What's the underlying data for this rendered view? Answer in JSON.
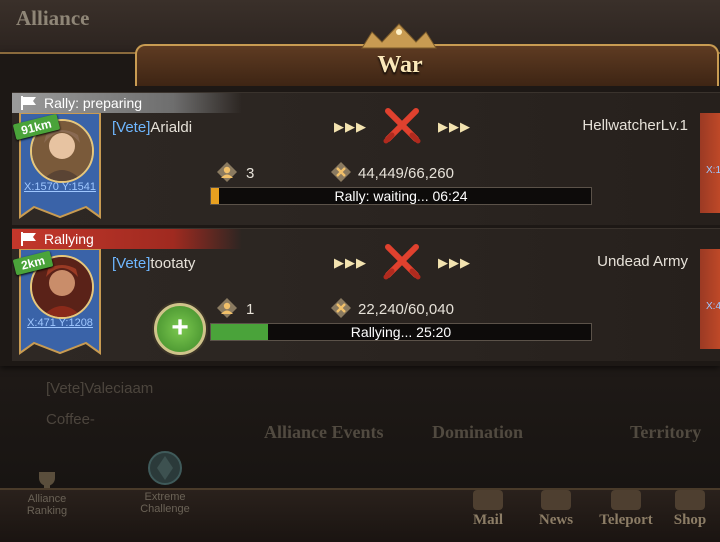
{
  "background": {
    "alliance_title": "Alliance",
    "members": [
      "[Vete]Valeciaam",
      "Coffee-"
    ],
    "tabs": [
      "Alliance Events",
      "Domination",
      "Territory"
    ],
    "left_buttons": [
      {
        "label": "Alliance Ranking",
        "icon": "trophy-icon"
      },
      {
        "label": "Extreme Challenge",
        "icon": "emblem-icon"
      }
    ],
    "bottom_nav": [
      {
        "label": "Mail",
        "icon": "mail-icon"
      },
      {
        "label": "News",
        "icon": "news-icon"
      },
      {
        "label": "Teleport",
        "icon": "teleport-icon"
      },
      {
        "label": "Shop",
        "icon": "shop-icon"
      }
    ]
  },
  "panel": {
    "title": "War"
  },
  "rallies": [
    {
      "status": "Rally: preparing",
      "status_color": "#8a8a8a",
      "distance": "91km",
      "coords": "X:1570 Y:1541",
      "leader_tag": "[Vete]",
      "leader_name": "Arialdi",
      "target": "HellwatcherLv.1",
      "participants": "3",
      "troops": "44,449/66,260",
      "progress_label": "Rally: waiting... 06:24",
      "progress": 0.02,
      "progress_color": "#e8a020",
      "edge_coords": "X:1"
    },
    {
      "status": "Rallying",
      "status_color": "#c3372b",
      "distance": "2km",
      "coords": "X:471 Y:1208",
      "leader_tag": "[Vete]",
      "leader_name": "tootaty",
      "target": "Undead Army",
      "participants": "1",
      "troops": "22,240/60,040",
      "progress_label": "Rallying... 25:20",
      "progress": 0.15,
      "progress_color": "#4aa33a",
      "edge_coords": "X:4"
    }
  ],
  "colors": {
    "accent_gold": "#c89b52",
    "leader_tag_blue": "#6fb7ff",
    "join_green": "#5aa83a"
  }
}
